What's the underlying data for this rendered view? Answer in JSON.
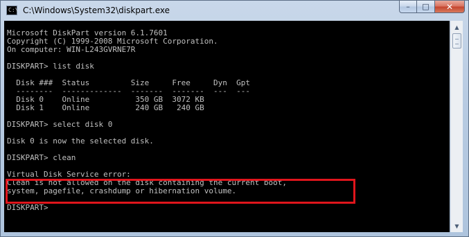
{
  "window": {
    "title": "C:\\Windows\\System32\\diskpart.exe",
    "icon": "cmd-console-icon",
    "controls": {
      "minimize": "–",
      "maximize": "□",
      "close": "✕"
    }
  },
  "console": {
    "lines": [
      "Microsoft DiskPart version 6.1.7601",
      "Copyright (C) 1999-2008 Microsoft Corporation.",
      "On computer: WIN-L243GVRNE7R",
      "",
      "DISKPART> list disk",
      "",
      "  Disk ###  Status         Size     Free     Dyn  Gpt",
      "  --------  -------------  -------  -------  ---  ---",
      "  Disk 0    Online          350 GB  3072 KB",
      "  Disk 1    Online          240 GB   240 GB",
      "",
      "DISKPART> select disk 0",
      "",
      "Disk 0 is now the selected disk.",
      "",
      "DISKPART> clean",
      "",
      "Virtual Disk Service error:",
      "Clean is not allowed on the disk containing the current boot,",
      "system, pagefile, crashdump or hibernation volume.",
      "",
      "DISKPART> "
    ]
  },
  "colors": {
    "console_background": "#000000",
    "console_text": "#c0c0c0",
    "highlight_border": "#e0151c"
  },
  "scrollbar": {
    "up_icon": "▲",
    "down_icon": "▼"
  }
}
